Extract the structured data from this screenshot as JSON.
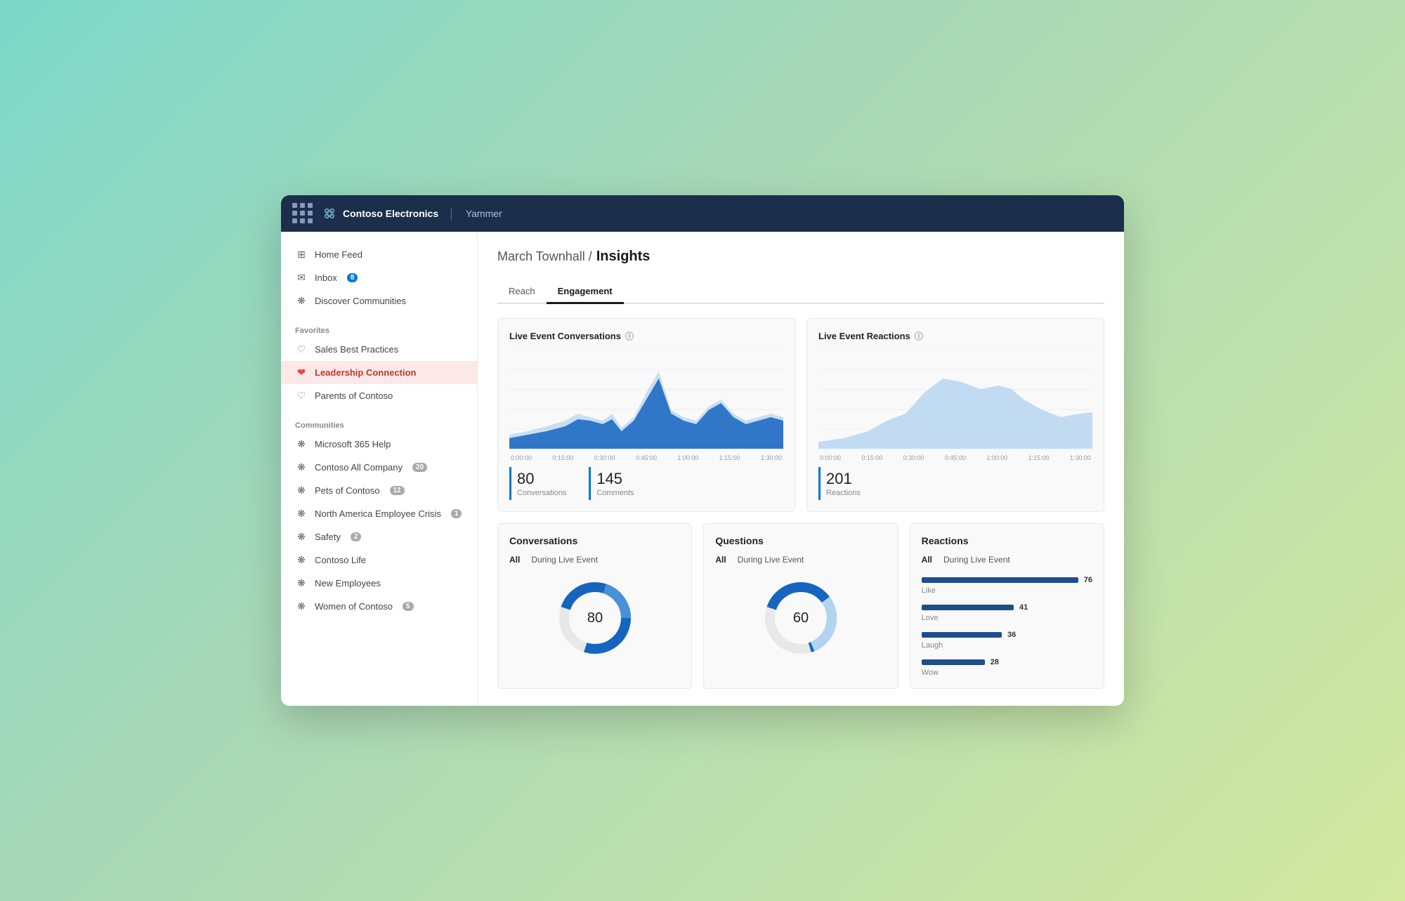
{
  "topbar": {
    "company": "Contoso Electronics",
    "app": "Yammer"
  },
  "sidebar": {
    "nav": [
      {
        "id": "home-feed",
        "label": "Home Feed",
        "icon": "⊞"
      },
      {
        "id": "inbox",
        "label": "Inbox",
        "icon": "✉",
        "badge": "8"
      },
      {
        "id": "discover-communities",
        "label": "Discover Communities",
        "icon": "❋"
      }
    ],
    "favorites_title": "Favorites",
    "favorites": [
      {
        "id": "sales-best-practices",
        "label": "Sales Best Practices",
        "icon": "♡"
      },
      {
        "id": "leadership-connection",
        "label": "Leadership Connection",
        "icon": "♥",
        "active": true
      },
      {
        "id": "parents-of-contoso",
        "label": "Parents of Contoso",
        "icon": "♡"
      }
    ],
    "communities_title": "Communities",
    "communities": [
      {
        "id": "ms365",
        "label": "Microsoft 365 Help",
        "icon": "❋"
      },
      {
        "id": "all-company",
        "label": "Contoso All Company",
        "icon": "❋",
        "badge": "20"
      },
      {
        "id": "pets",
        "label": "Pets of Contoso",
        "icon": "❋",
        "badge": "12"
      },
      {
        "id": "na-crisis",
        "label": "North America Employee Crisis",
        "icon": "❋",
        "badge": "1"
      },
      {
        "id": "safety",
        "label": "Safety",
        "icon": "❋",
        "badge": "2"
      },
      {
        "id": "contoso-life",
        "label": "Contoso Life",
        "icon": "❋"
      },
      {
        "id": "new-employees",
        "label": "New Employees",
        "icon": "❋"
      },
      {
        "id": "women",
        "label": "Women of Contoso",
        "icon": "❋",
        "badge": "5"
      }
    ]
  },
  "main": {
    "breadcrumb": "March Townhall /",
    "title": "Insights",
    "tabs": [
      {
        "id": "reach",
        "label": "Reach"
      },
      {
        "id": "engagement",
        "label": "Engagement",
        "active": true
      }
    ],
    "live_conversations": {
      "title": "Live Event Conversations",
      "stats": [
        {
          "num": "80",
          "label": "Conversations"
        },
        {
          "num": "145",
          "label": "Comments"
        }
      ],
      "x_labels": [
        "0:00:00",
        "0:15:00",
        "0:30:00",
        "0:45:00",
        "1:00:00",
        "1:15:00",
        "1:30:00"
      ]
    },
    "live_reactions": {
      "title": "Live Event Reactions",
      "stats": [
        {
          "num": "201",
          "label": "Reactions"
        }
      ],
      "x_labels": [
        "0:00:00",
        "0:15:00",
        "0:30:00",
        "0:45:00",
        "1:00:00",
        "1:15:00",
        "1:30:00"
      ]
    },
    "conversations_card": {
      "title": "Conversations",
      "filters": [
        "All",
        "During Live Event"
      ],
      "donut_value": "80"
    },
    "questions_card": {
      "title": "Questions",
      "filters": [
        "All",
        "During Live Event"
      ],
      "donut_value": "60"
    },
    "reactions_card": {
      "title": "Reactions",
      "filters": [
        "All",
        "During Live Event"
      ],
      "reactions": [
        {
          "name": "Like",
          "value": 76,
          "max": 76
        },
        {
          "name": "Love",
          "value": 41,
          "max": 76
        },
        {
          "name": "Laugh",
          "value": 36,
          "max": 76
        },
        {
          "name": "Wow",
          "value": 28,
          "max": 76
        }
      ]
    }
  }
}
